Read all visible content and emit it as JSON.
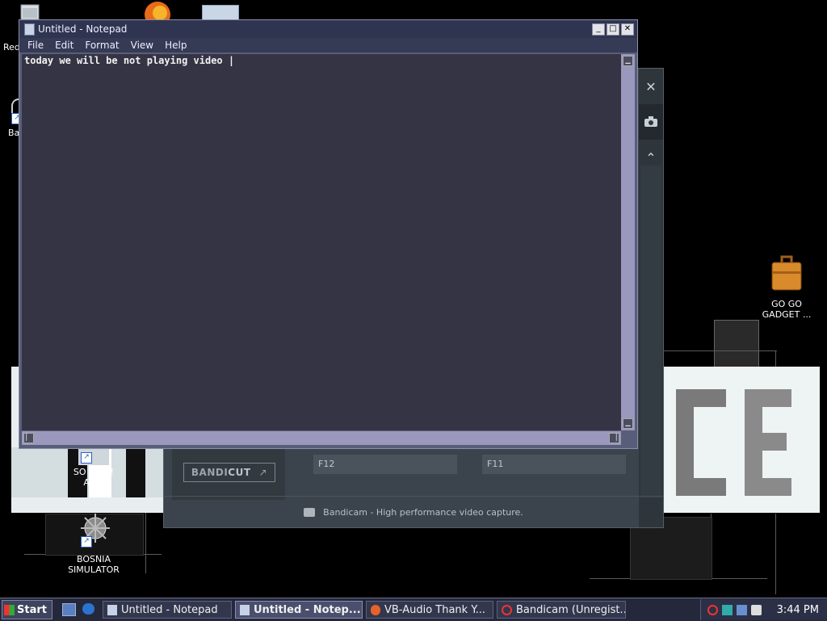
{
  "desktop": {
    "icons": [
      {
        "label": "Red",
        "kind": "recycle-bin"
      },
      {
        "label": "Ba",
        "kind": "bandicam-shortcut"
      },
      {
        "label": "SO LIFT!!\nAIRE",
        "kind": "game-shortcut"
      },
      {
        "label": "BOSNIA\nSIMULATOR",
        "kind": "game-shortcut"
      },
      {
        "label": "GO GO\nGADGET ...",
        "kind": "briefcase"
      }
    ]
  },
  "notepad": {
    "title": "Untitled - Notepad",
    "menu": [
      "File",
      "Edit",
      "Format",
      "View",
      "Help"
    ],
    "content": "today we will be not playing video |",
    "controls": {
      "minimize": "_",
      "maximize": "□",
      "close": "✕"
    }
  },
  "bandicam": {
    "bandicut_brand_a": "BANDI",
    "bandicut_brand_b": "CUT",
    "bandicut_arrow": "↗",
    "hotkey_left": "F12",
    "hotkey_right": "F11",
    "footer_text": "Bandicam - High performance video capture.",
    "side_buttons": [
      "close-icon",
      "camera-icon",
      "chevron-up-icon"
    ]
  },
  "taskbar": {
    "start_label": "Start",
    "tasks": [
      {
        "label": "Untitled - Notepad",
        "active": false
      },
      {
        "label": "Untitled - Notep...",
        "active": true
      },
      {
        "label": "VB-Audio Thank Y...",
        "active": false
      },
      {
        "label": "Bandicam (Unregist...",
        "active": false
      }
    ],
    "clock": "3:44 PM"
  },
  "colors": {
    "notepad_bg": "#343444",
    "titlebar": "#2f3550",
    "bandicam_panel": "#3b444c",
    "taskbar": "#25283a"
  }
}
